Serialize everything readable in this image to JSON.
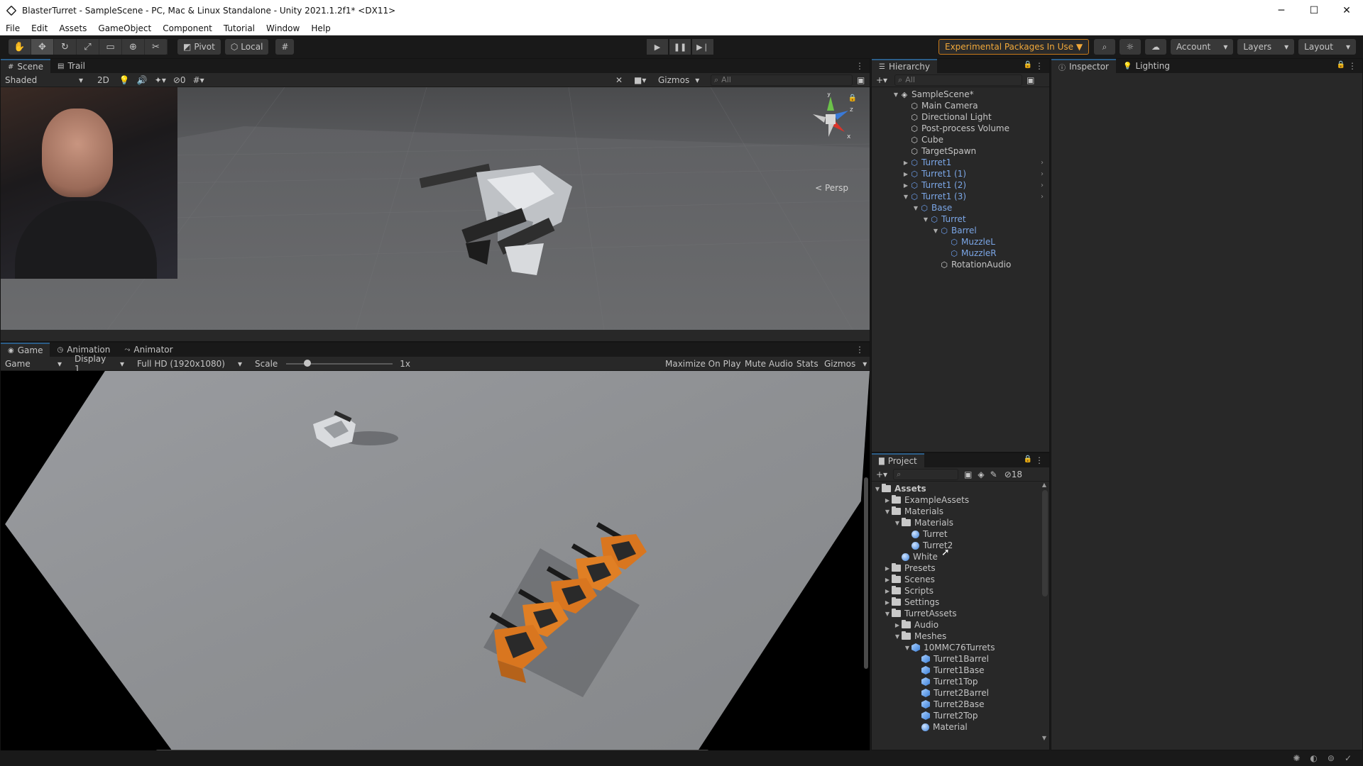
{
  "window": {
    "title": "BlasterTurret - SampleScene - PC, Mac & Linux Standalone - Unity 2021.1.2f1* <DX11>",
    "controls": [
      "─",
      "☐",
      "✕"
    ]
  },
  "menu": [
    "File",
    "Edit",
    "Assets",
    "GameObject",
    "Component",
    "Tutorial",
    "Window",
    "Help"
  ],
  "toolbar": {
    "pivot": "Pivot",
    "local": "Local",
    "experimental": "Experimental Packages In Use ▼",
    "account": "Account",
    "layers": "Layers",
    "layout": "Layout"
  },
  "scene_panel": {
    "tabs": [
      "Scene",
      "Trail"
    ],
    "shading": "Shaded",
    "mode_2d": "2D",
    "hidden_count": "0",
    "gizmos": "Gizmos",
    "search_placeholder": "All",
    "persp": "< Persp",
    "axis_y": "y",
    "axis_z": "z",
    "axis_x": "x"
  },
  "game_panel": {
    "tabs": [
      "Game",
      "Animation",
      "Animator"
    ],
    "mode": "Game",
    "display": "Display 1",
    "resolution": "Full HD (1920x1080)",
    "scale_label": "Scale",
    "scale_value": "1x",
    "scale_fraction": 0.2,
    "maximize": "Maximize On Play",
    "mute": "Mute Audio",
    "stats": "Stats",
    "gizmos": "Gizmos"
  },
  "hierarchy": {
    "tab": "Hierarchy",
    "search_placeholder": "All",
    "items": [
      {
        "label": "SampleScene*",
        "depth": 0,
        "type": "scene",
        "arrow": "▼"
      },
      {
        "label": "Main Camera",
        "depth": 1,
        "type": "go",
        "arrow": ""
      },
      {
        "label": "Directional Light",
        "depth": 1,
        "type": "go",
        "arrow": ""
      },
      {
        "label": "Post-process Volume",
        "depth": 1,
        "type": "go",
        "arrow": ""
      },
      {
        "label": "Cube",
        "depth": 1,
        "type": "go",
        "arrow": ""
      },
      {
        "label": "TargetSpawn",
        "depth": 1,
        "type": "go",
        "arrow": ""
      },
      {
        "label": "Turret1",
        "depth": 1,
        "type": "prefab",
        "arrow": "▶",
        "chev": true
      },
      {
        "label": "Turret1 (1)",
        "depth": 1,
        "type": "prefab",
        "arrow": "▶",
        "chev": true
      },
      {
        "label": "Turret1 (2)",
        "depth": 1,
        "type": "prefab",
        "arrow": "▶",
        "chev": true
      },
      {
        "label": "Turret1 (3)",
        "depth": 1,
        "type": "prefab",
        "arrow": "▼",
        "chev": true
      },
      {
        "label": "Base",
        "depth": 2,
        "type": "prefab",
        "arrow": "▼"
      },
      {
        "label": "Turret",
        "depth": 3,
        "type": "prefab",
        "arrow": "▼"
      },
      {
        "label": "Barrel",
        "depth": 4,
        "type": "prefab",
        "arrow": "▼"
      },
      {
        "label": "MuzzleL",
        "depth": 5,
        "type": "prefab",
        "arrow": ""
      },
      {
        "label": "MuzzleR",
        "depth": 5,
        "type": "prefab",
        "arrow": ""
      },
      {
        "label": "RotationAudio",
        "depth": 4,
        "type": "go",
        "arrow": ""
      }
    ]
  },
  "inspector": {
    "tabs": [
      "Inspector",
      "Lighting"
    ]
  },
  "project": {
    "tab": "Project",
    "hidden_count": "18",
    "items": [
      {
        "label": "Assets",
        "depth": 0,
        "type": "folder",
        "arrow": "▼",
        "bold": true
      },
      {
        "label": "ExampleAssets",
        "depth": 1,
        "type": "folder",
        "arrow": "▶"
      },
      {
        "label": "Materials",
        "depth": 1,
        "type": "folder",
        "arrow": "▼"
      },
      {
        "label": "Materials",
        "depth": 2,
        "type": "folder",
        "arrow": "▼"
      },
      {
        "label": "Turret",
        "depth": 3,
        "type": "mat",
        "arrow": ""
      },
      {
        "label": "Turret2",
        "depth": 3,
        "type": "mat",
        "arrow": ""
      },
      {
        "label": "White",
        "depth": 2,
        "type": "mat",
        "arrow": ""
      },
      {
        "label": "Presets",
        "depth": 1,
        "type": "folder",
        "arrow": "▶"
      },
      {
        "label": "Scenes",
        "depth": 1,
        "type": "folder",
        "arrow": "▶"
      },
      {
        "label": "Scripts",
        "depth": 1,
        "type": "folder",
        "arrow": "▶"
      },
      {
        "label": "Settings",
        "depth": 1,
        "type": "folder",
        "arrow": "▶"
      },
      {
        "label": "TurretAssets",
        "depth": 1,
        "type": "folder",
        "arrow": "▼"
      },
      {
        "label": "Audio",
        "depth": 2,
        "type": "folder",
        "arrow": "▶"
      },
      {
        "label": "Meshes",
        "depth": 2,
        "type": "folder",
        "arrow": "▼"
      },
      {
        "label": "10MMC76Turrets",
        "depth": 3,
        "type": "mesh",
        "arrow": "▼"
      },
      {
        "label": "Turret1Barrel",
        "depth": 4,
        "type": "mesh",
        "arrow": ""
      },
      {
        "label": "Turret1Base",
        "depth": 4,
        "type": "mesh",
        "arrow": ""
      },
      {
        "label": "Turret1Top",
        "depth": 4,
        "type": "mesh",
        "arrow": ""
      },
      {
        "label": "Turret2Barrel",
        "depth": 4,
        "type": "mesh",
        "arrow": ""
      },
      {
        "label": "Turret2Base",
        "depth": 4,
        "type": "mesh",
        "arrow": ""
      },
      {
        "label": "Turret2Top",
        "depth": 4,
        "type": "mesh",
        "arrow": ""
      },
      {
        "label": "Material",
        "depth": 4,
        "type": "mat",
        "arrow": ""
      }
    ]
  },
  "colors": {
    "accent": "#2c5d87",
    "experimental": "#f0a83a",
    "prefab_text": "#7ba6e6"
  }
}
